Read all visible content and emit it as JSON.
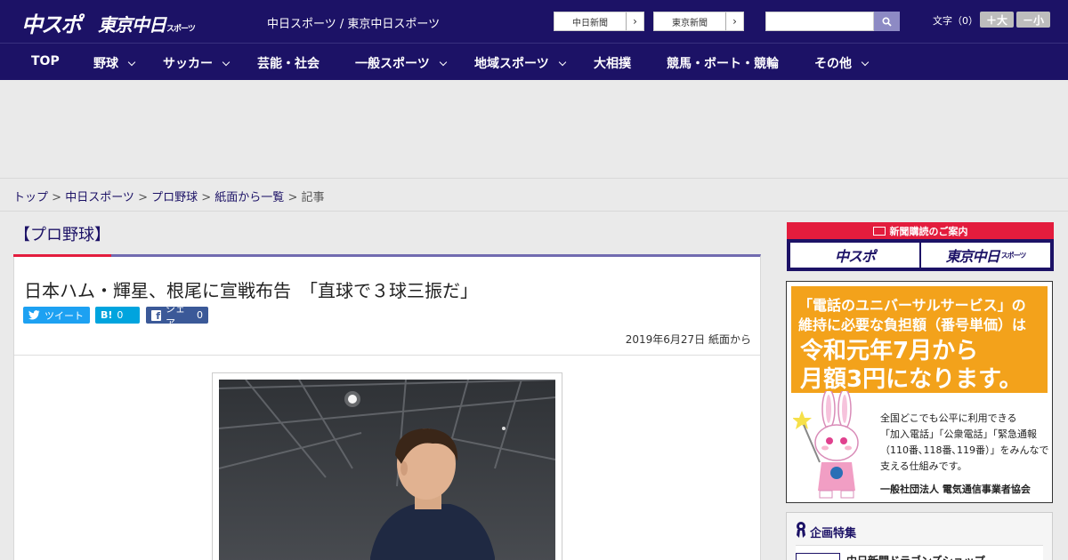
{
  "header": {
    "logo_chuspo": "中スポ",
    "logo_tokyo": "東京中日",
    "logo_tokyo_sub": "スポーツ",
    "site_links": "中日スポーツ / 東京中日スポーツ",
    "btn_chunichi": "中日新聞",
    "btn_tokyo": "東京新聞",
    "search_placeholder": "",
    "font_size_label": "文字（0）",
    "font_plus": "＋大",
    "font_minus": "－小"
  },
  "nav": {
    "items": [
      {
        "label": "TOP"
      },
      {
        "label": "野球"
      },
      {
        "label": "サッカー"
      },
      {
        "label": "芸能・社会"
      },
      {
        "label": "一般スポーツ"
      },
      {
        "label": "地域スポーツ"
      },
      {
        "label": "大相撲"
      },
      {
        "label": "競馬・ボート・競輪"
      },
      {
        "label": "その他"
      }
    ]
  },
  "breadcrumb": {
    "items": [
      "トップ",
      "中日スポーツ",
      "プロ野球",
      "紙面から一覧"
    ],
    "current": "記事",
    "sep": " > "
  },
  "article": {
    "category": "【プロ野球】",
    "headline": "日本ハム・輝星、根尾に宣戦布告　「直球で３球三振だ」",
    "share_tweet": "ツイート",
    "share_hatena_icon": "B!",
    "share_hatena_count": "0",
    "share_fb_label": "シェア",
    "share_fb_count": "0",
    "date": "2019年6月27日 紙面から"
  },
  "sidebar": {
    "subscribe_title": "新聞購読のご案内",
    "sub_chuspo": "中スポ",
    "sub_tokyo": "東京中日",
    "sub_tokyo_small": "スポーツ",
    "banner_l1": "「電話のユニバーサルサービス」の",
    "banner_l2": "維持に必要な負担額（番号単価）は",
    "banner_l3": "令和元年7月から",
    "banner_l4": "月額3円になります。",
    "banner_desc": "全国どこでも公平に利用できる\n「加入電話」「公衆電話」「緊急通報\n（110番､118番､119番）」をみんなで\n支える仕組みです。",
    "banner_org": "一般社団法人 電気通信事業者協会",
    "feature_title": "企画特集",
    "feature_item": "中日新聞ドラゴンズショップ"
  },
  "colors": {
    "brand_navy": "#1c1266",
    "accent_red": "#e31c3d",
    "twitter": "#1da1f2",
    "hatena": "#00a4de",
    "facebook": "#3b5998",
    "banner_orange": "#f3a21b"
  }
}
